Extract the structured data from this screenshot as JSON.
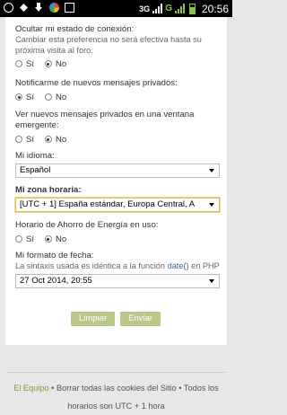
{
  "statusbar": {
    "network": "3G",
    "g_badge": "G",
    "time": "20:56",
    "icons": [
      "whatsapp-icon",
      "dropbox-icon",
      "download-icon",
      "picasa-icon",
      "image-icon"
    ]
  },
  "form": {
    "hide_status": {
      "label": "Ocultar mi estado de conexión:",
      "help": "Cambiar esta preferencia no será efectiva hasta su próxima visita al foro.",
      "yes": "Sí",
      "no": "No",
      "selected": "No"
    },
    "notify_pm": {
      "label": "Notificarme de nuevos mensajes privados:",
      "yes": "Sí",
      "no": "No",
      "selected": "Sí"
    },
    "popup_pm": {
      "label": "Ver nuevos mensajes privados en una ventana emergente:",
      "yes": "Sí",
      "no": "No",
      "selected": "No"
    },
    "language": {
      "label": "Mi idioma:",
      "value": "Español"
    },
    "timezone": {
      "label": "Mi zona horaria:",
      "value": "[UTC + 1] España estándar, Europa Central, A"
    },
    "dst": {
      "label": "Horario de Ahorro de Energía en uso:",
      "yes": "Sí",
      "no": "No",
      "selected": "No"
    },
    "date_format": {
      "label": "Mi formato de fecha:",
      "help_prefix": "La sintaxis usada es idéntica a la función ",
      "help_link": "date()",
      "help_suffix": " en PHP",
      "value": "27 Oct 2014, 20:55"
    },
    "reset_label": "Limpiar",
    "submit_label": "Enviar"
  },
  "footer": {
    "team_link": "El Equipo",
    "sep1": " • ",
    "cookies_link": "Borrar todas las cookies del Sitio",
    "sep2": " • ",
    "tz_text": "Todos los horarios son UTC + 1 hora"
  },
  "colors": {
    "button": "#b9c889",
    "link": "#3a66a0",
    "footer_link": "#7f9a3a",
    "focus_border": "#e0b860"
  }
}
